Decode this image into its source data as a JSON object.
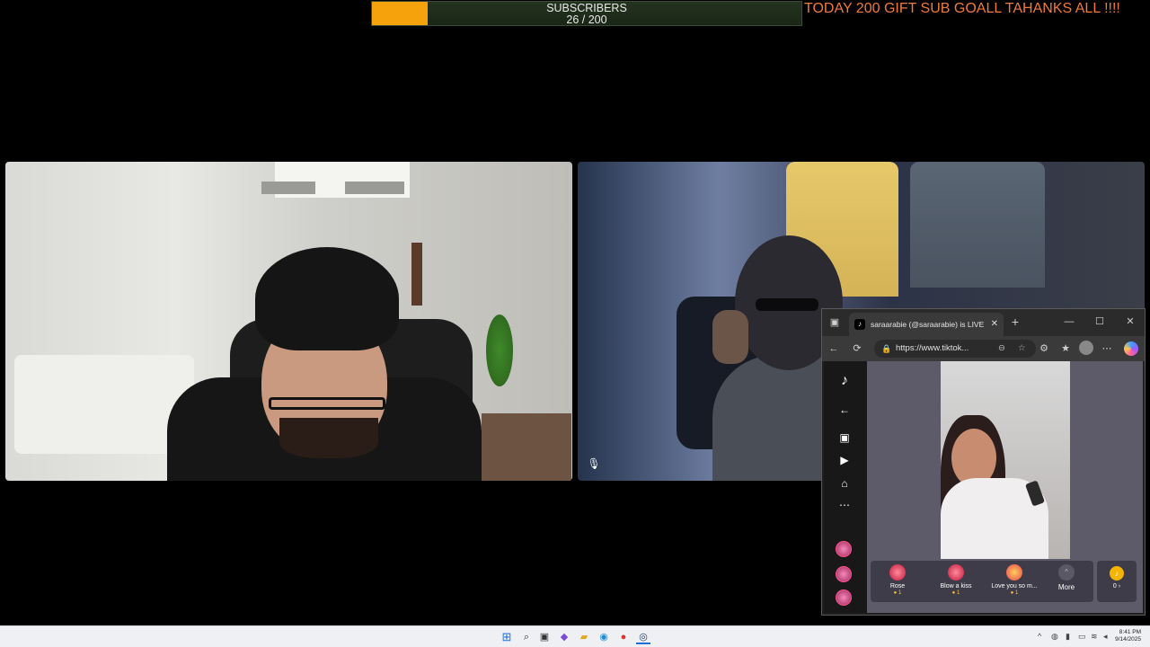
{
  "overlay": {
    "sub_label": "SUBSCRIBERS",
    "sub_count": "26 / 200",
    "sub_progress": 0.13,
    "goal_text": "TODAY 200 GIFT SUB GOALL TAHANKS ALL !!!!",
    "goal_color": "#f07a3a",
    "bar_fill_color": "#f5a20c"
  },
  "cams": {
    "left_icon": "none",
    "right_icon": "microphone-muted-icon"
  },
  "browser": {
    "tab_title": "saraarabie (@saraarabie) is LIVE",
    "url": "https://www.tiktok...",
    "nav_icons": [
      "tiktok-logo-icon",
      "back-arrow-icon",
      "live-icon",
      "video-icon",
      "home-icon",
      "more-icon"
    ],
    "gifts": [
      {
        "name": "Rose",
        "cost": "1"
      },
      {
        "name": "Blow a kiss",
        "cost": "1"
      },
      {
        "name": "Love you so m...",
        "cost": "1"
      }
    ],
    "more_label": "More",
    "coin_label": "0 ›",
    "accent": "#fe2c55"
  },
  "taskbar": {
    "time": "8:41 PM",
    "date": "9/14/2025"
  }
}
